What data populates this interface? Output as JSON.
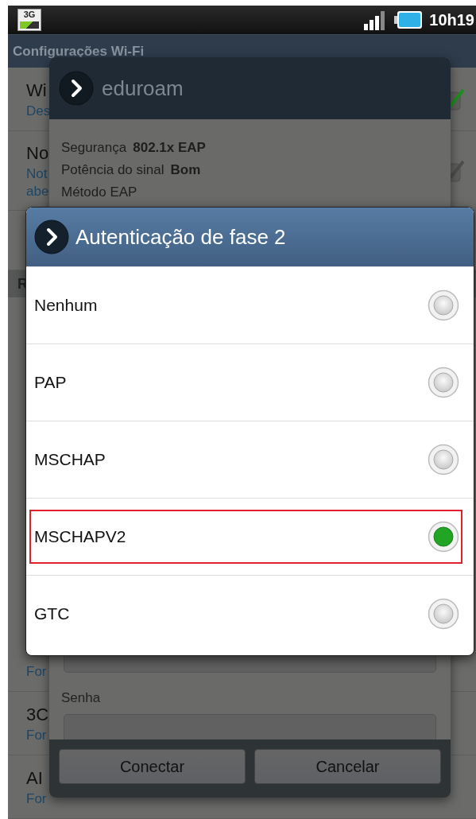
{
  "status_bar": {
    "network": "3G",
    "time": "10h19"
  },
  "title_bar": {
    "title": "Configurações Wi-Fi"
  },
  "settings_list": {
    "top_rows": [
      {
        "title": "Wi",
        "subtitle": [
          "Des"
        ],
        "checked": true
      },
      {
        "title": "No",
        "subtitle": [
          "Not",
          "abe"
        ],
        "checked": false
      }
    ],
    "section_header": "R",
    "bottom_rows": [
      {
        "subtitle": [
          "For"
        ]
      },
      {
        "title": "3C",
        "subtitle": [
          "For"
        ]
      },
      {
        "title": "AI",
        "subtitle": [
          "For"
        ]
      }
    ]
  },
  "network_dialog": {
    "title": "eduroam",
    "info": [
      {
        "label": "Segurança",
        "value": "802.1x EAP"
      },
      {
        "label": "Potência do sinal",
        "value": "Bom"
      },
      {
        "label": "Método EAP"
      }
    ],
    "password_label": "Senha",
    "buttons": [
      "Conectar",
      "Cancelar"
    ]
  },
  "phase2_dialog": {
    "title": "Autenticação de fase 2",
    "options": [
      {
        "label": "Nenhum",
        "selected": false
      },
      {
        "label": "PAP",
        "selected": false
      },
      {
        "label": "MSCHAP",
        "selected": false
      },
      {
        "label": "MSCHAPV2",
        "selected": true
      },
      {
        "label": "GTC",
        "selected": false
      }
    ]
  }
}
